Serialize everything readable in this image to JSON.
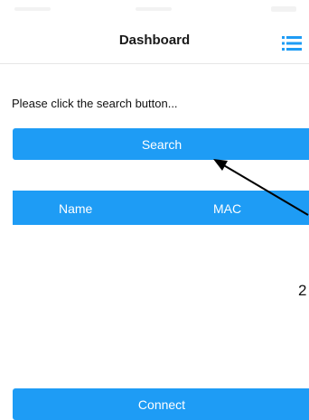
{
  "nav": {
    "title": "Dashboard",
    "menu_icon": "list-menu-icon"
  },
  "main": {
    "instruction": "Please click the search button...",
    "search_label": "Search",
    "table": {
      "columns": [
        "Name",
        "MAC"
      ],
      "rows": []
    },
    "connect_label": "Connect"
  },
  "annotation": {
    "number": "2"
  },
  "colors": {
    "accent": "#1e9cf5",
    "background": "#ffffff",
    "text": "#111111"
  }
}
